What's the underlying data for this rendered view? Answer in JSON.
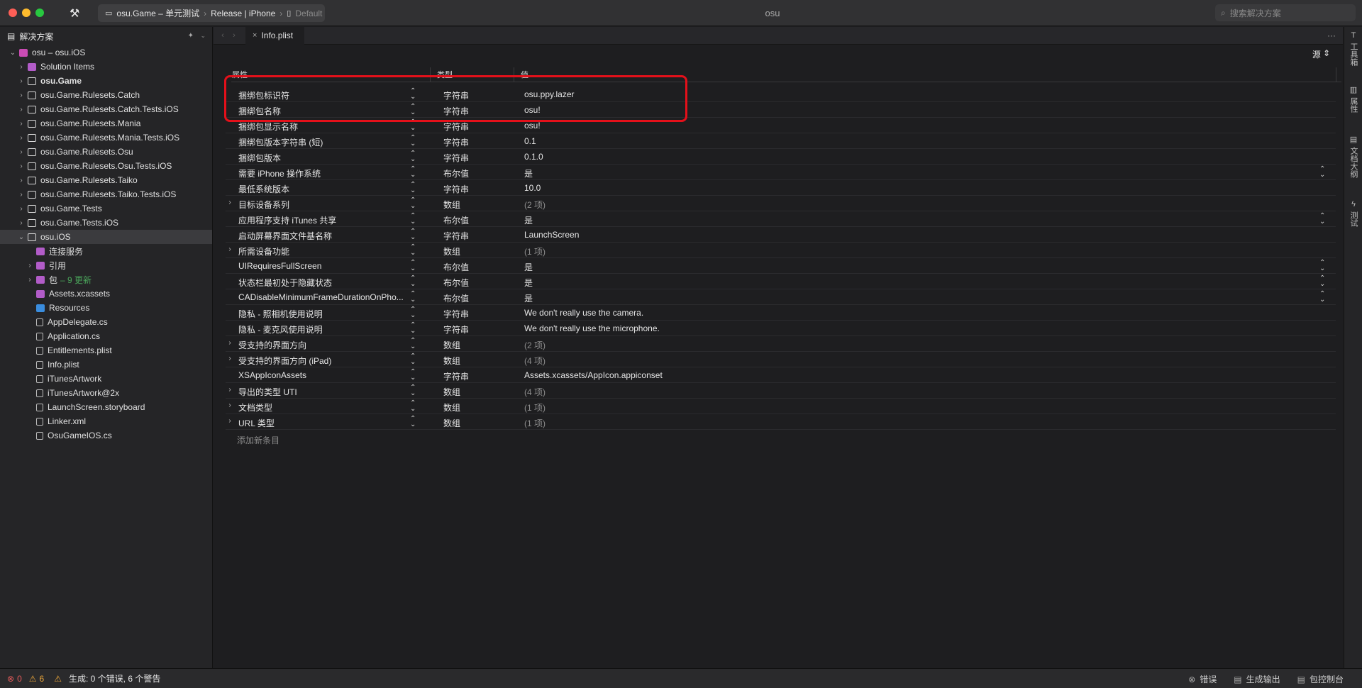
{
  "window": {
    "title": "osu"
  },
  "toolbar": {
    "scheme": "osu.Game – 单元测试",
    "config": "Release | iPhone",
    "device": "Default",
    "search_placeholder": "搜索解决方案"
  },
  "sidebar": {
    "title": "解决方案",
    "items": [
      {
        "label": "osu – osu.iOS",
        "level": 0,
        "expand": "down",
        "icon": "solution-icon",
        "bold": false
      },
      {
        "label": "Solution Items",
        "level": 1,
        "expand": "right",
        "icon": "folder-icon",
        "bold": false
      },
      {
        "label": "osu.Game",
        "level": 1,
        "expand": "right",
        "icon": "project-icon",
        "bold": true
      },
      {
        "label": "osu.Game.Rulesets.Catch",
        "level": 1,
        "expand": "right",
        "icon": "project-icon",
        "bold": false
      },
      {
        "label": "osu.Game.Rulesets.Catch.Tests.iOS",
        "level": 1,
        "expand": "right",
        "icon": "project-icon",
        "bold": false
      },
      {
        "label": "osu.Game.Rulesets.Mania",
        "level": 1,
        "expand": "right",
        "icon": "project-icon",
        "bold": false
      },
      {
        "label": "osu.Game.Rulesets.Mania.Tests.iOS",
        "level": 1,
        "expand": "right",
        "icon": "project-icon",
        "bold": false
      },
      {
        "label": "osu.Game.Rulesets.Osu",
        "level": 1,
        "expand": "right",
        "icon": "project-icon",
        "bold": false
      },
      {
        "label": "osu.Game.Rulesets.Osu.Tests.iOS",
        "level": 1,
        "expand": "right",
        "icon": "project-icon",
        "bold": false
      },
      {
        "label": "osu.Game.Rulesets.Taiko",
        "level": 1,
        "expand": "right",
        "icon": "project-icon",
        "bold": false
      },
      {
        "label": "osu.Game.Rulesets.Taiko.Tests.iOS",
        "level": 1,
        "expand": "right",
        "icon": "project-icon",
        "bold": false
      },
      {
        "label": "osu.Game.Tests",
        "level": 1,
        "expand": "right",
        "icon": "project-icon",
        "bold": false
      },
      {
        "label": "osu.Game.Tests.iOS",
        "level": 1,
        "expand": "right",
        "icon": "project-icon",
        "bold": false
      },
      {
        "label": "osu.iOS",
        "level": 1,
        "expand": "down",
        "icon": "project-icon",
        "bold": false,
        "selected": true
      },
      {
        "label": "连接服务",
        "level": 2,
        "expand": "",
        "icon": "folder-icon",
        "bold": false
      },
      {
        "label": "引用",
        "level": 2,
        "expand": "right",
        "icon": "folder-icon",
        "bold": false
      },
      {
        "label": "包",
        "level": 2,
        "expand": "right",
        "icon": "folder-icon",
        "bold": false,
        "update": "– 9 更新"
      },
      {
        "label": "Assets.xcassets",
        "level": 2,
        "expand": "",
        "icon": "folder-icon",
        "bold": false
      },
      {
        "label": "Resources",
        "level": 2,
        "expand": "",
        "icon": "blue-folder-icon",
        "bold": false
      },
      {
        "label": "AppDelegate.cs",
        "level": 2,
        "expand": "",
        "icon": "csharp-file-icon",
        "bold": false
      },
      {
        "label": "Application.cs",
        "level": 2,
        "expand": "",
        "icon": "csharp-file-icon",
        "bold": false
      },
      {
        "label": "Entitlements.plist",
        "level": 2,
        "expand": "",
        "icon": "plist-file-icon",
        "bold": false
      },
      {
        "label": "Info.plist",
        "level": 2,
        "expand": "",
        "icon": "plist-file-icon",
        "bold": false
      },
      {
        "label": "iTunesArtwork",
        "level": 2,
        "expand": "",
        "icon": "file-icon",
        "bold": false
      },
      {
        "label": "iTunesArtwork@2x",
        "level": 2,
        "expand": "",
        "icon": "file-icon",
        "bold": false
      },
      {
        "label": "LaunchScreen.storyboard",
        "level": 2,
        "expand": "",
        "icon": "storyboard-file-icon",
        "bold": false
      },
      {
        "label": "Linker.xml",
        "level": 2,
        "expand": "",
        "icon": "xml-file-icon",
        "bold": false
      },
      {
        "label": "OsuGameIOS.cs",
        "level": 2,
        "expand": "",
        "icon": "csharp-file-icon",
        "bold": false
      }
    ]
  },
  "editor": {
    "tab": "Info.plist",
    "source_label": "源",
    "columns": {
      "property": "属性",
      "type": "类型",
      "value": "值"
    },
    "add_entry": "添加新条目",
    "rows": [
      {
        "key": "捆绑包标识符",
        "type": "字符串",
        "value": "osu.ppy.lazer",
        "expandable": false,
        "dim": false,
        "dropdown": false
      },
      {
        "key": "捆绑包名称",
        "type": "字符串",
        "value": "osu!",
        "expandable": false,
        "dim": false,
        "dropdown": false
      },
      {
        "key": "捆绑包显示名称",
        "type": "字符串",
        "value": "osu!",
        "expandable": false,
        "dim": false,
        "dropdown": false
      },
      {
        "key": "捆绑包版本字符串 (短)",
        "type": "字符串",
        "value": "0.1",
        "expandable": false,
        "dim": false,
        "dropdown": false
      },
      {
        "key": "捆绑包版本",
        "type": "字符串",
        "value": "0.1.0",
        "expandable": false,
        "dim": false,
        "dropdown": false
      },
      {
        "key": "需要 iPhone 操作系统",
        "type": "布尔值",
        "value": "是",
        "expandable": false,
        "dim": false,
        "dropdown": true
      },
      {
        "key": "最低系统版本",
        "type": "字符串",
        "value": "10.0",
        "expandable": false,
        "dim": false,
        "dropdown": false
      },
      {
        "key": "目标设备系列",
        "type": "数组",
        "value": "(2 项)",
        "expandable": true,
        "dim": true,
        "dropdown": false
      },
      {
        "key": "应用程序支持 iTunes 共享",
        "type": "布尔值",
        "value": "是",
        "expandable": false,
        "dim": false,
        "dropdown": true
      },
      {
        "key": "启动屏幕界面文件基名称",
        "type": "字符串",
        "value": "LaunchScreen",
        "expandable": false,
        "dim": false,
        "dropdown": false
      },
      {
        "key": "所需设备功能",
        "type": "数组",
        "value": "(1 项)",
        "expandable": true,
        "dim": true,
        "dropdown": false
      },
      {
        "key": "UIRequiresFullScreen",
        "type": "布尔值",
        "value": "是",
        "expandable": false,
        "dim": false,
        "dropdown": true
      },
      {
        "key": "状态栏最初处于隐藏状态",
        "type": "布尔值",
        "value": "是",
        "expandable": false,
        "dim": false,
        "dropdown": true
      },
      {
        "key": "CADisableMinimumFrameDurationOnPho...",
        "type": "布尔值",
        "value": "是",
        "expandable": false,
        "dim": false,
        "dropdown": true
      },
      {
        "key": "隐私 - 照相机使用说明",
        "type": "字符串",
        "value": "We don't really use the camera.",
        "expandable": false,
        "dim": false,
        "dropdown": false
      },
      {
        "key": "隐私 - 麦克风使用说明",
        "type": "字符串",
        "value": "We don't really use the microphone.",
        "expandable": false,
        "dim": false,
        "dropdown": false
      },
      {
        "key": "受支持的界面方向",
        "type": "数组",
        "value": "(2 项)",
        "expandable": true,
        "dim": true,
        "dropdown": false
      },
      {
        "key": "受支持的界面方向 (iPad)",
        "type": "数组",
        "value": "(4 项)",
        "expandable": true,
        "dim": true,
        "dropdown": false
      },
      {
        "key": "XSAppIconAssets",
        "type": "字符串",
        "value": "Assets.xcassets/AppIcon.appiconset",
        "expandable": false,
        "dim": false,
        "dropdown": false
      },
      {
        "key": "导出的类型 UTI",
        "type": "数组",
        "value": "(4 项)",
        "expandable": true,
        "dim": true,
        "dropdown": false
      },
      {
        "key": "文档类型",
        "type": "数组",
        "value": "(1 项)",
        "expandable": true,
        "dim": true,
        "dropdown": false
      },
      {
        "key": "URL 类型",
        "type": "数组",
        "value": "(1 项)",
        "expandable": true,
        "dim": true,
        "dropdown": false
      }
    ]
  },
  "right_panel": {
    "items": [
      "工具箱",
      "属性",
      "文档大纲",
      "测试"
    ]
  },
  "statusbar": {
    "error_count": "0",
    "warning_count": "6",
    "build_status": "生成: 0 个错误, 6 个警告",
    "errors_label": "错误",
    "build_output_label": "生成输出",
    "package_console_label": "包控制台"
  },
  "colors": {
    "highlight": "#e4101a",
    "background": "#1e1e20",
    "sidebar": "#252527"
  }
}
